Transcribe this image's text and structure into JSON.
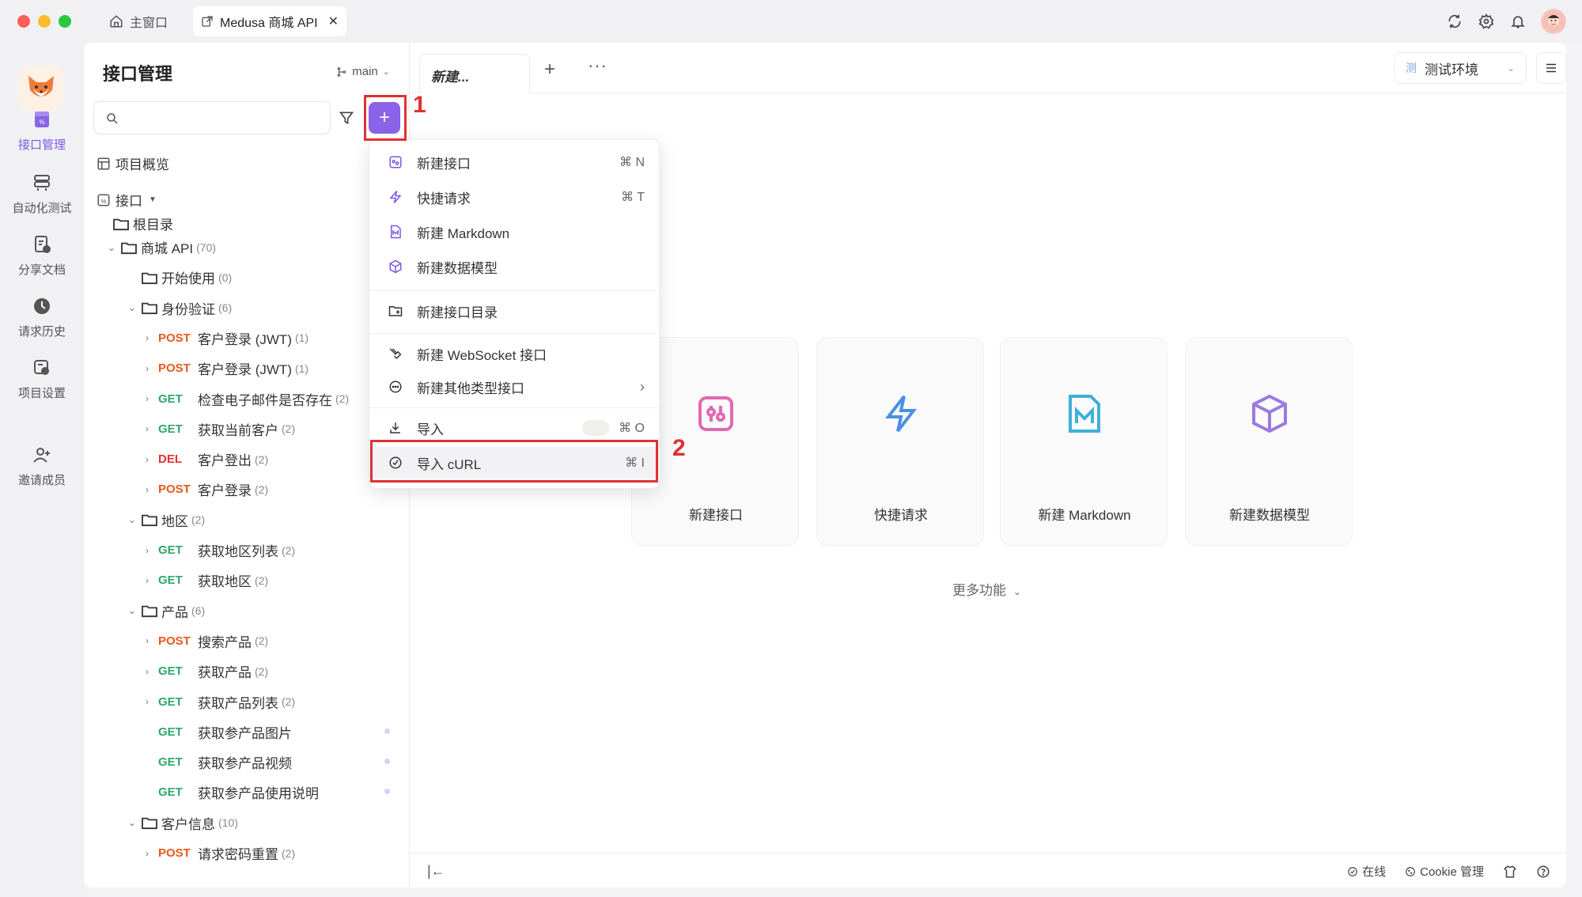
{
  "titlebar": {
    "home_label": "主窗口",
    "active_tab_label": "Medusa 商城 API",
    "close_glyph": "✕"
  },
  "leftnav": {
    "items": [
      {
        "label": "接口管理",
        "icon": "api-icon"
      },
      {
        "label": "自动化测试",
        "icon": "automation-icon"
      },
      {
        "label": "分享文档",
        "icon": "share-doc-icon"
      },
      {
        "label": "请求历史",
        "icon": "history-icon"
      },
      {
        "label": "项目设置",
        "icon": "settings-icon"
      },
      {
        "label": "邀请成员",
        "icon": "invite-icon"
      }
    ]
  },
  "sidebar": {
    "title": "接口管理",
    "branch": "main",
    "overview": "项目概览",
    "api_section": "接口",
    "root": "根目录",
    "tree": [
      {
        "type": "folder",
        "label": "商城 API",
        "count": "(70)",
        "level": 1,
        "expanded": true
      },
      {
        "type": "folder",
        "label": "开始使用",
        "count": "(0)",
        "level": 2,
        "expanded": false
      },
      {
        "type": "folder",
        "label": "身份验证",
        "count": "(6)",
        "level": 2,
        "expanded": true
      },
      {
        "type": "api",
        "method": "POST",
        "label": "客户登录 (JWT)",
        "count": "(1)",
        "level": 3
      },
      {
        "type": "api",
        "method": "POST",
        "label": "客户登录 (JWT)",
        "count": "(1)",
        "level": 3
      },
      {
        "type": "api",
        "method": "GET",
        "label": "检查电子邮件是否存在",
        "count": "(2)",
        "level": 3
      },
      {
        "type": "api",
        "method": "GET",
        "label": "获取当前客户",
        "count": "(2)",
        "level": 3
      },
      {
        "type": "api",
        "method": "DEL",
        "label": "客户登出",
        "count": "(2)",
        "level": 3
      },
      {
        "type": "api",
        "method": "POST",
        "label": "客户登录",
        "count": "(2)",
        "level": 3
      },
      {
        "type": "folder",
        "label": "地区",
        "count": "(2)",
        "level": 2,
        "expanded": true
      },
      {
        "type": "api",
        "method": "GET",
        "label": "获取地区列表",
        "count": "(2)",
        "level": 3
      },
      {
        "type": "api",
        "method": "GET",
        "label": "获取地区",
        "count": "(2)",
        "level": 3
      },
      {
        "type": "folder",
        "label": "产品",
        "count": "(6)",
        "level": 2,
        "expanded": true
      },
      {
        "type": "api",
        "method": "POST",
        "label": "搜索产品",
        "count": "(2)",
        "level": 3
      },
      {
        "type": "api",
        "method": "GET",
        "label": "获取产品",
        "count": "(2)",
        "level": 3
      },
      {
        "type": "api",
        "method": "GET",
        "label": "获取产品列表",
        "count": "(2)",
        "level": 3
      },
      {
        "type": "api",
        "method": "GET",
        "label": "获取参产品图片",
        "count": "",
        "level": 3,
        "leaf": true
      },
      {
        "type": "api",
        "method": "GET",
        "label": "获取参产品视频",
        "count": "",
        "level": 3,
        "leaf": true
      },
      {
        "type": "api",
        "method": "GET",
        "label": "获取参产品使用说明",
        "count": "",
        "level": 3,
        "leaf": true
      },
      {
        "type": "folder",
        "label": "客户信息",
        "count": "(10)",
        "level": 2,
        "expanded": true
      },
      {
        "type": "api",
        "method": "POST",
        "label": "请求密码重置",
        "count": "(2)",
        "level": 3
      }
    ]
  },
  "annotations": {
    "step1": "1",
    "step2": "2"
  },
  "main": {
    "tab_label": "新建...",
    "env_tag": "测",
    "env_label": "测试环境",
    "cards": [
      {
        "label": "新建接口",
        "icon": "new-api-icon"
      },
      {
        "label": "快捷请求",
        "icon": "lightning-icon"
      },
      {
        "label": "新建 Markdown",
        "icon": "markdown-icon"
      },
      {
        "label": "新建数据模型",
        "icon": "cube-icon"
      }
    ],
    "more": "更多功能"
  },
  "dropdown": {
    "items": [
      {
        "label": "新建接口",
        "shortcut": "⌘ N",
        "icon": "new-api-icon"
      },
      {
        "label": "快捷请求",
        "shortcut": "⌘ T",
        "icon": "lightning-icon"
      },
      {
        "label": "新建 Markdown",
        "shortcut": "",
        "icon": "markdown-icon"
      },
      {
        "label": "新建数据模型",
        "shortcut": "",
        "icon": "cube-icon"
      },
      {
        "label": "新建接口目录",
        "shortcut": "",
        "icon": "folder-add-icon"
      },
      {
        "label": "新建 WebSocket 接口",
        "shortcut": "",
        "icon": "websocket-icon"
      },
      {
        "label": "新建其他类型接口",
        "shortcut": "",
        "icon": "more-circle-icon"
      },
      {
        "label": "导入",
        "shortcut": "⌘ O",
        "icon": "import-icon"
      },
      {
        "label": "导入 cURL",
        "shortcut": "⌘ I",
        "icon": "curl-icon"
      }
    ]
  },
  "statusbar": {
    "online": "在线",
    "cookie": "Cookie 管理"
  },
  "colors": {
    "accent": "#8a63e8",
    "post": "#e8581c",
    "get": "#2fa86a",
    "del": "#e03131",
    "annotation": "#e03131"
  }
}
